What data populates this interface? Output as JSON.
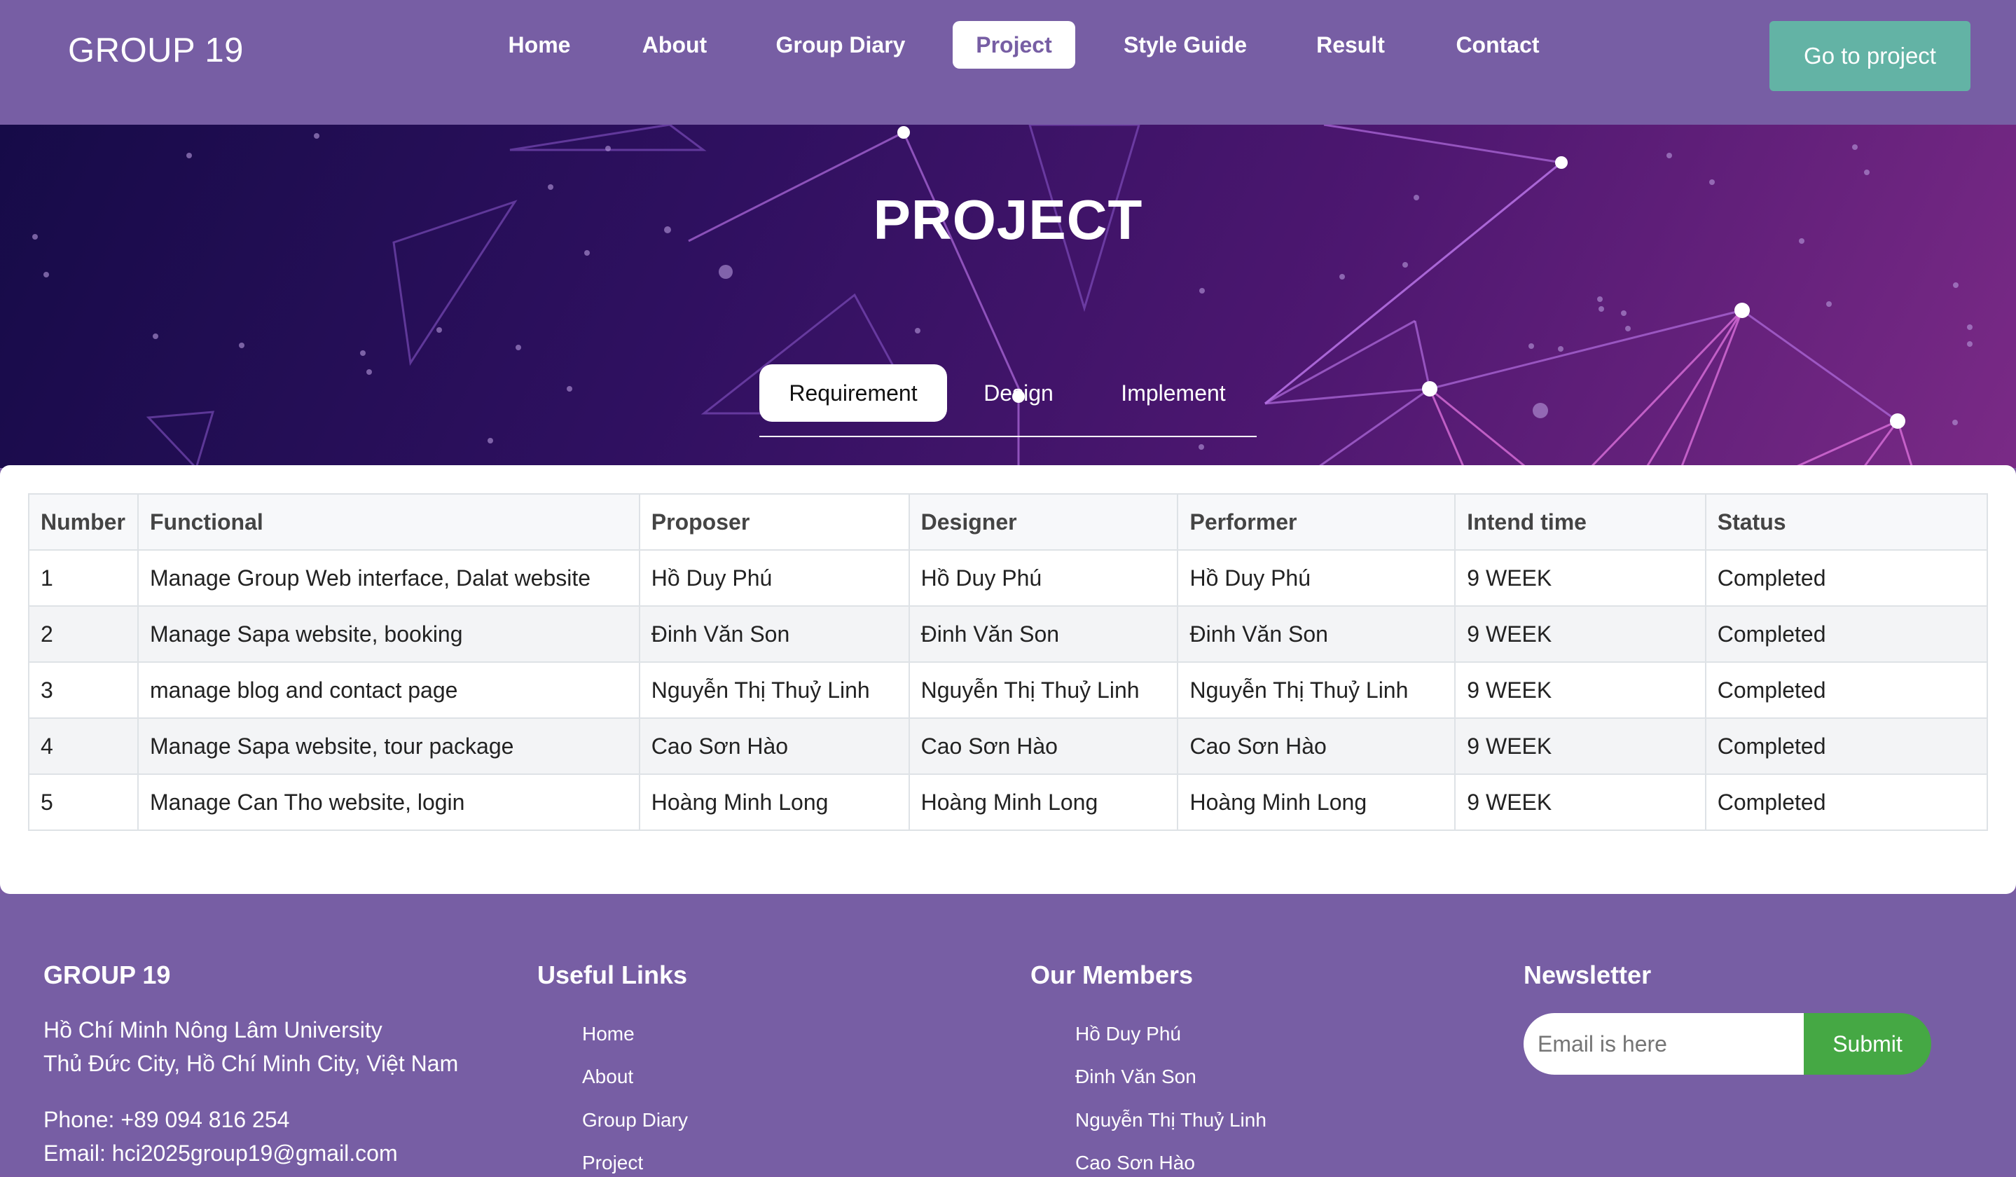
{
  "header": {
    "brand": "GROUP 19",
    "nav": [
      "Home",
      "About",
      "Group Diary",
      "Project",
      "Style Guide",
      "Result",
      "Contact"
    ],
    "active_nav": "Project",
    "cta_label": "Go to project"
  },
  "hero": {
    "title": "PROJECT",
    "tabs": [
      "Requirement",
      "Design",
      "Implement"
    ],
    "active_tab": "Requirement"
  },
  "table": {
    "headers": [
      "Number",
      "Functional",
      "Proposer",
      "Designer",
      "Performer",
      "Intend time",
      "Status"
    ],
    "rows": [
      [
        "1",
        "Manage Group Web interface, Dalat website",
        "Hồ Duy Phú",
        "Hồ Duy Phú",
        "Hồ Duy Phú",
        "9 WEEK",
        "Completed"
      ],
      [
        "2",
        "Manage Sapa website, booking",
        "Đinh Văn Son",
        "Đinh Văn Son",
        "Đinh Văn Son",
        "9 WEEK",
        "Completed"
      ],
      [
        "3",
        "manage blog and contact page",
        "Nguyễn Thị Thuỷ Linh",
        "Nguyễn Thị Thuỷ Linh",
        "Nguyễn Thị Thuỷ Linh",
        "9 WEEK",
        "Completed"
      ],
      [
        "4",
        "Manage Sapa website, tour package",
        "Cao Sơn Hào",
        "Cao Sơn Hào",
        "Cao Sơn Hào",
        "9 WEEK",
        "Completed"
      ],
      [
        "5",
        "Manage Can Tho website, login",
        "Hoàng Minh Long",
        "Hoàng Minh Long",
        "Hoàng Minh Long",
        "9 WEEK",
        "Completed"
      ]
    ]
  },
  "footer": {
    "brand": "GROUP 19",
    "address_line1": "Hồ Chí Minh Nông Lâm University",
    "address_line2": "Thủ Đức City, Hồ Chí Minh City, Việt Nam",
    "phone": "Phone: +89 094 816 254",
    "email": "Email: hci2025group19@gmail.com",
    "links_title": "Useful Links",
    "links": [
      "Home",
      "About",
      "Group Diary",
      "Project"
    ],
    "members_title": "Our Members",
    "members": [
      "Hồ Duy Phú",
      "Đinh Văn Son",
      "Nguyễn Thị Thuỷ Linh",
      "Cao Sơn Hào"
    ],
    "newsletter_title": "Newsletter",
    "newsletter_placeholder": "Email is here",
    "newsletter_button": "Submit"
  },
  "colors": {
    "header_bg": "#775ea4",
    "cta_bg": "#63b3a5",
    "submit_bg": "#45a844",
    "hero_start": "#160b48",
    "hero_end": "#7a2a86"
  }
}
